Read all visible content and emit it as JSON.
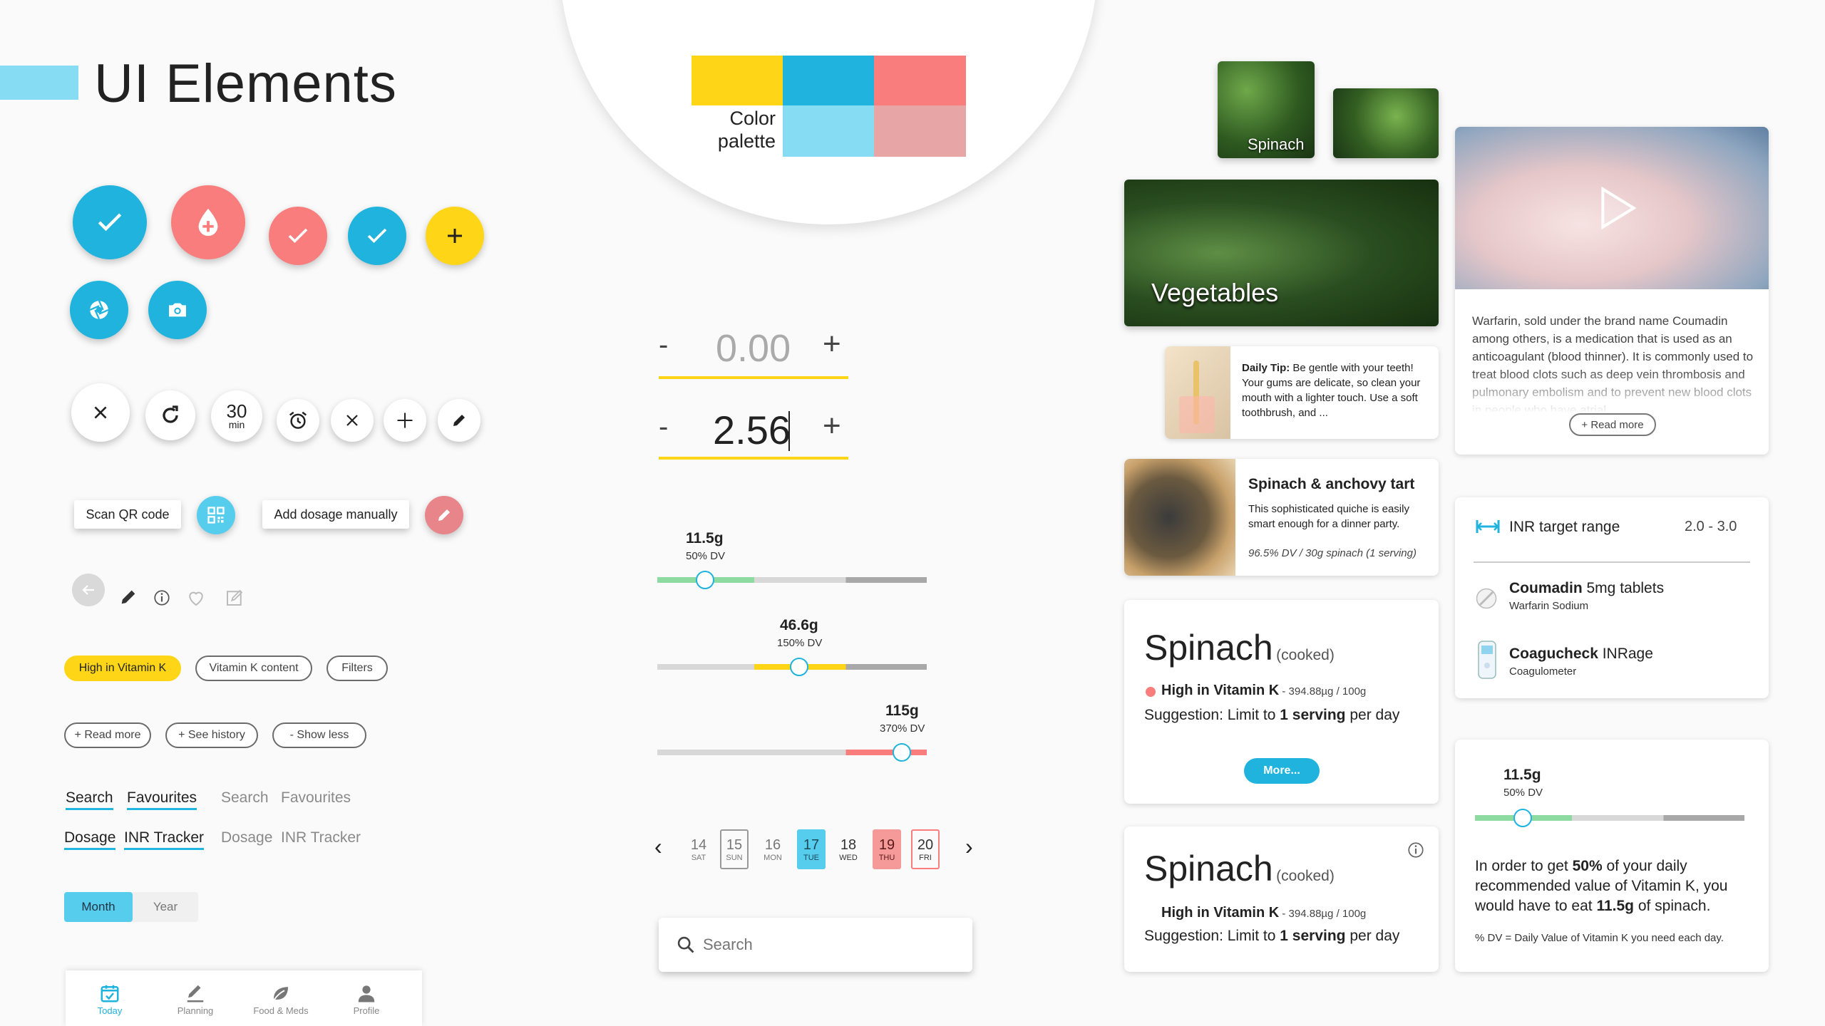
{
  "header": {
    "title": "UI Elements"
  },
  "colors": {
    "yellow": "#ffd617",
    "blue": "#1fb3dd",
    "coral": "#f87d7c",
    "light_blue": "#86dcf2",
    "pink": "#e8a5a5",
    "accent": "#21b6df"
  },
  "palette": {
    "label_line1": "Color",
    "label_line2": "palette"
  },
  "icon_buttons": {
    "timer_value": "30",
    "timer_unit": "min"
  },
  "action_row": {
    "scan_label": "Scan QR code",
    "manual_label": "Add dosage manually"
  },
  "chips": {
    "high_vitk": "High in Vitamin K",
    "vitk_content": "Vitamin K content",
    "filters": "Filters"
  },
  "link_chips": {
    "read_more": "+ Read more",
    "see_history": "+ See history",
    "show_less": "- Show less"
  },
  "tabs_a": {
    "search": "Search",
    "favourites": "Favourites",
    "search_muted": "Search",
    "favourites_muted": "Favourites"
  },
  "tabs_b": {
    "dosage": "Dosage",
    "inr": "INR Tracker",
    "dosage_muted": "Dosage",
    "inr_muted": "INR Tracker"
  },
  "toggle": {
    "month": "Month",
    "year": "Year"
  },
  "bottom_nav": [
    {
      "label": "Today",
      "icon": "calendar-icon",
      "active": true
    },
    {
      "label": "Planning",
      "icon": "pencil-icon",
      "active": false
    },
    {
      "label": "Food & Meds",
      "icon": "leaf-icon",
      "active": false
    },
    {
      "label": "Profile",
      "icon": "person-icon",
      "active": false
    }
  ],
  "steppers": {
    "empty_value": "0.00",
    "filled_value": "2.56",
    "minus": "-",
    "plus": "+"
  },
  "sliders": [
    {
      "amount": "11.5g",
      "dv": "50% DV",
      "fraction": 0.18,
      "level": "green"
    },
    {
      "amount": "46.6g",
      "dv": "150% DV",
      "fraction": 0.52,
      "level": "yellow"
    },
    {
      "amount": "115g",
      "dv": "370% DV",
      "fraction": 0.91,
      "level": "red"
    }
  ],
  "calendar": {
    "prev": "‹",
    "next": "›",
    "days": [
      {
        "num": "14",
        "dow": "SAT",
        "style": "plain"
      },
      {
        "num": "15",
        "dow": "SUN",
        "style": "outlined"
      },
      {
        "num": "16",
        "dow": "MON",
        "style": "plain"
      },
      {
        "num": "17",
        "dow": "TUE",
        "style": "selected-blue"
      },
      {
        "num": "18",
        "dow": "WED",
        "style": "plain"
      },
      {
        "num": "19",
        "dow": "THU",
        "style": "selected-red"
      },
      {
        "num": "20",
        "dow": "FRI",
        "style": "outlined-red"
      }
    ]
  },
  "search": {
    "placeholder": "Search"
  },
  "images": {
    "spinach_label": "Spinach",
    "vegetables_label": "Vegetables"
  },
  "tip_card": {
    "bold": "Daily Tip:",
    "text": " Be gentle with your teeth! Your gums are delicate, so clean your mouth with a lighter touch. Use a soft toothbrush, and ..."
  },
  "recipe_card": {
    "title": "Spinach & anchovy tart",
    "desc": "This sophisticated quiche is easily smart enough for a dinner party.",
    "meta": "96.5% DV / 30g spinach (1 serving)"
  },
  "food_card1": {
    "name": "Spinach",
    "qualifier": "(cooked)",
    "badge": "High in Vitamin K",
    "amount": " - 394.88µg / 100g",
    "suggestion_pre": "Suggestion: Limit to ",
    "suggestion_bold": "1 serving",
    "suggestion_post": " per day",
    "more": "More..."
  },
  "food_card2": {
    "name": "Spinach",
    "qualifier": "(cooked)",
    "badge": "High in Vitamin K",
    "amount": " - 394.88µg / 100g",
    "suggestion_pre": "Suggestion: Limit to ",
    "suggestion_bold": "1 serving",
    "suggestion_post": " per day"
  },
  "video_card": {
    "text": "Warfarin, sold under the brand name Coumadin among others, is a medication that is used as an anticoagulant (blood thinner). It is commonly used to treat blood clots such as deep vein thrombosis and pulmonary embolism and to prevent new blood clots in people who have atrial",
    "read_more": "+ Read more"
  },
  "inr_card": {
    "title": "INR target range",
    "range": "2.0 - 3.0",
    "med1_bold": "Coumadin",
    "med1_rest": " 5mg tablets",
    "med1_sub": "Warfarin Sodium",
    "med2_bold": "Coagucheck",
    "med2_rest": " INRage",
    "med2_sub": "Coagulometer"
  },
  "dv_card": {
    "amount": "11.5g",
    "dv": "50% DV",
    "fraction": 0.18,
    "text_pre": "In order to get ",
    "text_bold1": "50%",
    "text_mid": " of your daily recommended value of Vitamin K, you would have to eat ",
    "text_bold2": "11.5g",
    "text_post": " of spinach.",
    "footnote": "% DV = Daily Value of Vitamin K you need each day."
  }
}
